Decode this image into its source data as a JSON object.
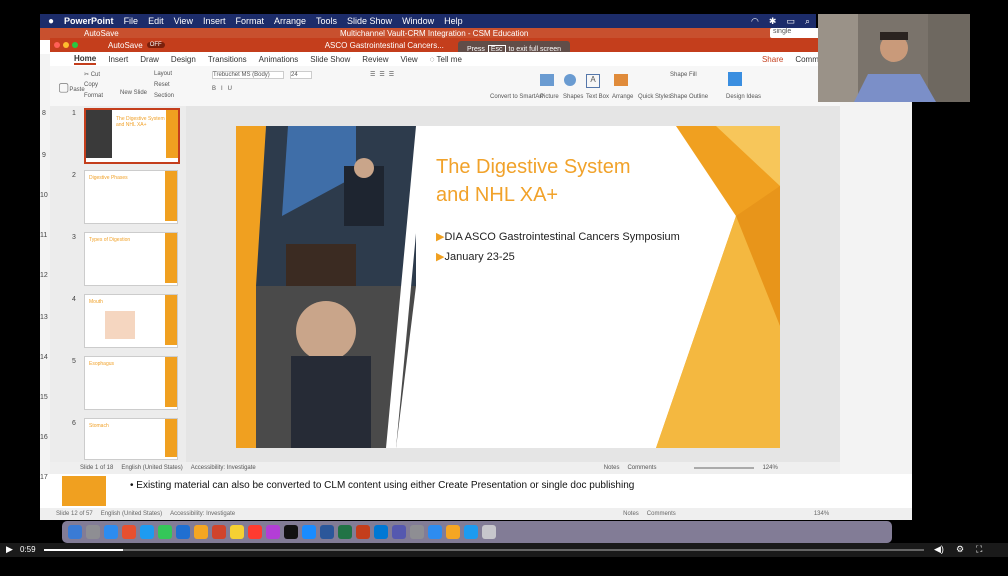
{
  "menubar": {
    "apple": "",
    "app": "PowerPoint",
    "items": [
      "File",
      "Edit",
      "View",
      "Insert",
      "Format",
      "Arrange",
      "Tools",
      "Slide Show",
      "Window",
      "Help"
    ]
  },
  "back_window": {
    "title": "Multichannel Vault-CRM Integration - CSM Education",
    "autosave": "AutoSave",
    "search": "single",
    "home_tab": "Home"
  },
  "front_window": {
    "title": "ASCO Gastrointestinal Cancers...",
    "autosave": "AutoSave",
    "autosave_state": "OFF"
  },
  "esc_notice": {
    "press": "Press",
    "key": "Esc",
    "rest": "to exit full screen"
  },
  "ribbon": {
    "tabs": [
      "Home",
      "Insert",
      "Draw",
      "Design",
      "Transitions",
      "Animations",
      "Slide Show",
      "Review",
      "View",
      "Tell me"
    ],
    "share": "Share",
    "comments": "Comments",
    "clipboard": {
      "paste": "Paste",
      "cut": "Cut",
      "copy": "Copy",
      "format": "Format"
    },
    "slides": {
      "new_slide": "New Slide",
      "layout": "Layout",
      "reset": "Reset",
      "section": "Section"
    },
    "font": "Trebuchet MS (Body)",
    "font_size": "24",
    "tools": [
      "Convert to SmartArt",
      "Picture",
      "Shapes",
      "Text Box",
      "Arrange",
      "Quick Styles",
      "Shape Fill",
      "Shape Outline",
      "Design Ideas"
    ]
  },
  "thumbnails": [
    {
      "num": "1",
      "title": "The Digestive System and NHL XA+"
    },
    {
      "num": "2",
      "title": "Digestive Phases"
    },
    {
      "num": "3",
      "title": "Types of Digestion"
    },
    {
      "num": "4",
      "title": "Mouth"
    },
    {
      "num": "5",
      "title": "Esophagus"
    },
    {
      "num": "6",
      "title": "Stomach"
    }
  ],
  "back_thumb_numbers": [
    "8",
    "9",
    "10",
    "11",
    "12",
    "13",
    "14",
    "15",
    "16",
    "17"
  ],
  "slide": {
    "title_line1": "The Digestive System",
    "title_line2": "and NHL XA+",
    "bullets": [
      "DIA ASCO Gastrointestinal Cancers Symposium",
      "January 23-25"
    ],
    "bullet_marker": "▶"
  },
  "front_status": {
    "slide_of": "Slide 1 of 18",
    "language": "English (United States)",
    "accessibility": "Accessibility: Investigate",
    "notes": "Notes",
    "comments": "Comments",
    "zoom": "124%"
  },
  "bottom_slide": {
    "bullet": "Existing material can also be converted to CLM content using either Create Presentation or single doc publishing",
    "thumb_num": "17"
  },
  "back_status": {
    "slide_of": "Slide 12 of 57",
    "language": "English (United States)",
    "accessibility": "Accessibility: Investigate",
    "notes": "Notes",
    "comments": "Comments",
    "zoom": "134%"
  },
  "video": {
    "time": "0:59",
    "progress": 0.09
  },
  "colors": {
    "accent_orange": "#f0a020",
    "title_orange": "#f1a22a",
    "ppt_red": "#c43e1c",
    "menubar": "#1c2c6a"
  }
}
